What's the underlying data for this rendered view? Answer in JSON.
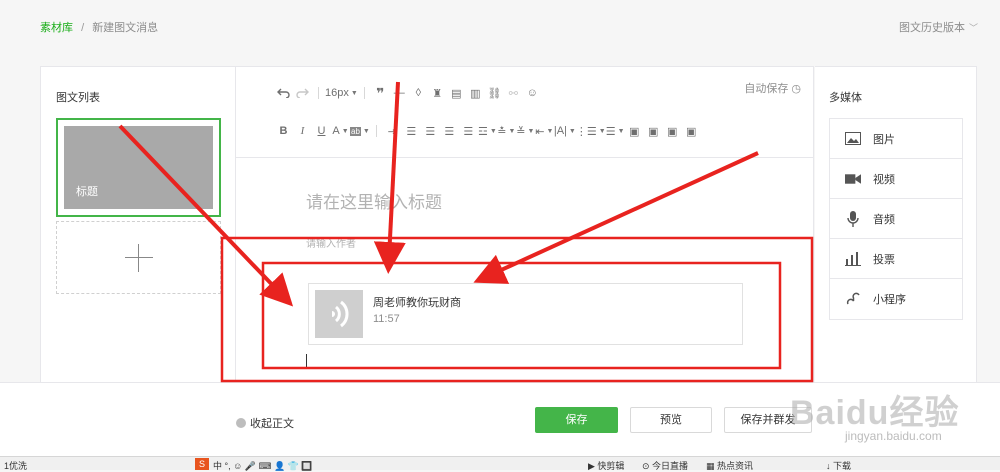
{
  "breadcrumb": {
    "root": "素材库",
    "separator": "/",
    "current": "新建图文消息"
  },
  "history_label": "图文历史版本",
  "left_panel": {
    "title": "图文列表",
    "card_title": "标题"
  },
  "editor": {
    "font_size": "16px",
    "autosave": "自动保存",
    "title_placeholder": "请在这里输入标题",
    "author_placeholder": "请输入作者",
    "voice": {
      "title": "周老师教你玩财商",
      "duration": "11:57"
    }
  },
  "media_panel": {
    "title": "多媒体",
    "items": [
      {
        "label": "图片",
        "icon": "image-icon"
      },
      {
        "label": "视频",
        "icon": "video-icon"
      },
      {
        "label": "音频",
        "icon": "audio-icon"
      },
      {
        "label": "投票",
        "icon": "vote-icon"
      },
      {
        "label": "小程序",
        "icon": "miniprogram-icon"
      }
    ]
  },
  "footer": {
    "collapse": "收起正文",
    "save": "保存",
    "preview": "预览",
    "publish": "保存并群发"
  },
  "taskbar": {
    "left": "1优洗",
    "ime_logo": "S",
    "ime_text": "中 °, ☺ 🎤 ⌨ 👤 👕 🔲",
    "kuaijian": "快剪辑",
    "live": "今日直播",
    "news": "热点资讯",
    "download": "下载"
  },
  "watermark": {
    "main": "Baidu经验",
    "url": "jingyan.baidu.com"
  },
  "colors": {
    "accent": "#44b549",
    "annotation": "#e8231f"
  }
}
